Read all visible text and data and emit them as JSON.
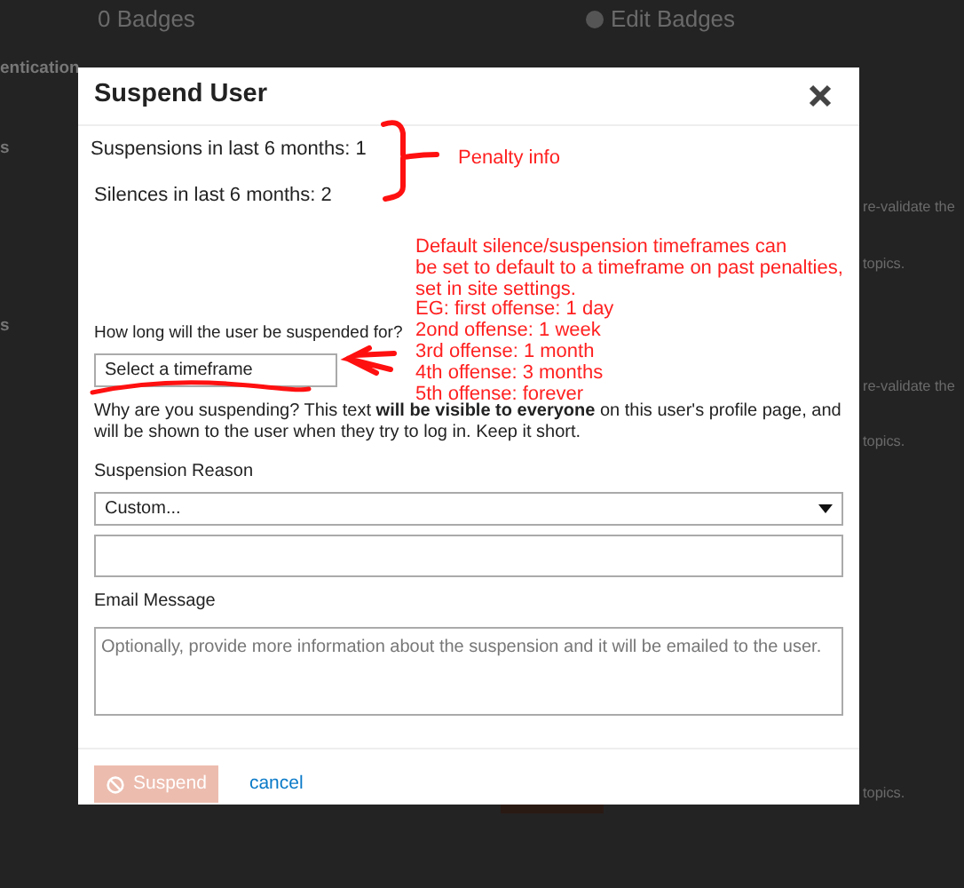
{
  "background_page": {
    "badges": "0 Badges",
    "edit_badges": "Edit Badges",
    "left_fragments": [
      "entication",
      "s",
      "s"
    ],
    "right_fragments": [
      "re-validate the",
      "topics.",
      "re-validate the",
      "topics.",
      "topics."
    ]
  },
  "modal": {
    "title": "Suspend User",
    "penalty_info": [
      "Suspensions in last 6 months: 1",
      "Silences in last 6 months: 2"
    ],
    "duration_label": "How long will the user be suspended for?",
    "duration_select": {
      "value": "Select a timeframe"
    },
    "explanation": "Why are you suspending? This text **will be visible to everyone** on this user's profile page, and will be shown to the user when they try to log in. Keep it short.",
    "reason_label": "Suspension Reason",
    "reason_select": {
      "value": "Custom..."
    },
    "email_label": "Email Message",
    "email_field": {
      "placeholder": "Optionally, provide more information about the suspension and it will be emailed to the user."
    },
    "suspend_button": {
      "label": "Suspend",
      "disabled": true
    },
    "cancel_link": "cancel"
  },
  "annotations": {
    "penalty_note": "Penalty info",
    "timeframe_note": [
      "Default silence/suspension timeframes can",
      "be set to default to a timeframe on past penalties,",
      "set in site settings.",
      "EG: first offense: 1 day",
      "2ond offense: 1 week",
      "3rd offense: 1 month",
      "4th offense: 3 months",
      "5th offense: forever"
    ]
  }
}
